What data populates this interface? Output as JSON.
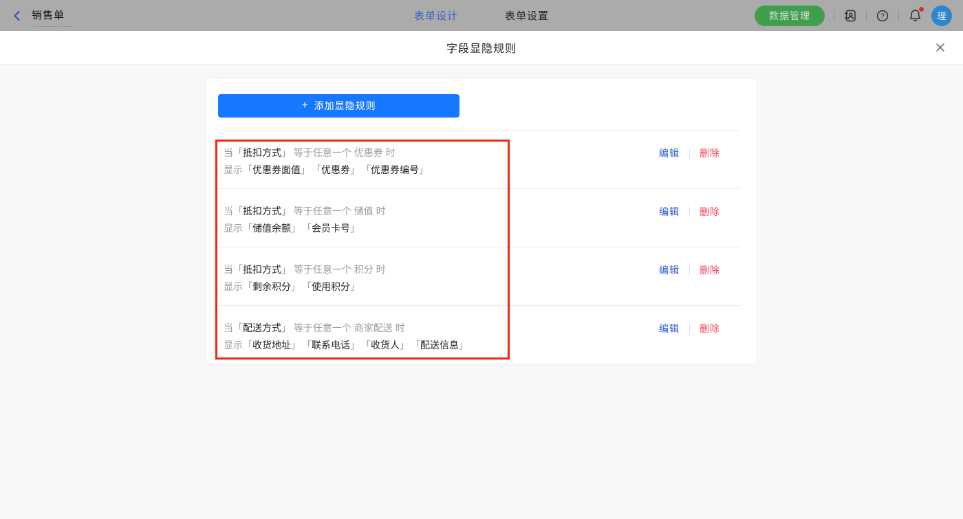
{
  "topbar": {
    "form_title": "销售单",
    "tabs": [
      {
        "label": "表单设计",
        "active": true
      },
      {
        "label": "表单设置",
        "active": false
      }
    ],
    "data_manage_button": "数据管理",
    "avatar_text": "理",
    "has_notification_dot": true
  },
  "modal": {
    "title": "字段显隐规则",
    "add_rule_button": {
      "plus": "+",
      "label": "添加显隐规则"
    },
    "edit_label": "编辑",
    "delete_label": "删除",
    "bracket_open": "「",
    "bracket_close": "」",
    "rules": [
      {
        "when_prefix": "当",
        "when_field": "抵扣方式",
        "when_middle": "等于任意一个",
        "when_value": "优惠券",
        "when_suffix": "时",
        "show_prefix": "显示",
        "show_fields": [
          "优惠券面值",
          "优惠券",
          "优惠券编号"
        ]
      },
      {
        "when_prefix": "当",
        "when_field": "抵扣方式",
        "when_middle": "等于任意一个",
        "when_value": "储值",
        "when_suffix": "时",
        "show_prefix": "显示",
        "show_fields": [
          "储值余额",
          "会员卡号"
        ]
      },
      {
        "when_prefix": "当",
        "when_field": "抵扣方式",
        "when_middle": "等于任意一个",
        "when_value": "积分",
        "when_suffix": "时",
        "show_prefix": "显示",
        "show_fields": [
          "剩余积分",
          "使用积分"
        ]
      },
      {
        "when_prefix": "当",
        "when_field": "配送方式",
        "when_middle": "等于任意一个",
        "when_value": "商家配送",
        "when_suffix": "时",
        "show_prefix": "显示",
        "show_fields": [
          "收货地址",
          "联系电话",
          "收货人",
          "配送信息"
        ]
      }
    ]
  },
  "colors": {
    "accent_blue": "#1677ff",
    "edit_blue": "#2e5bd6",
    "delete_red": "#f5455c",
    "annotation_red": "#f7230f",
    "green_button": "#3f9f4c",
    "topbar_dimmed_bg": "#ababab",
    "body_bg": "#f7f8fa"
  }
}
